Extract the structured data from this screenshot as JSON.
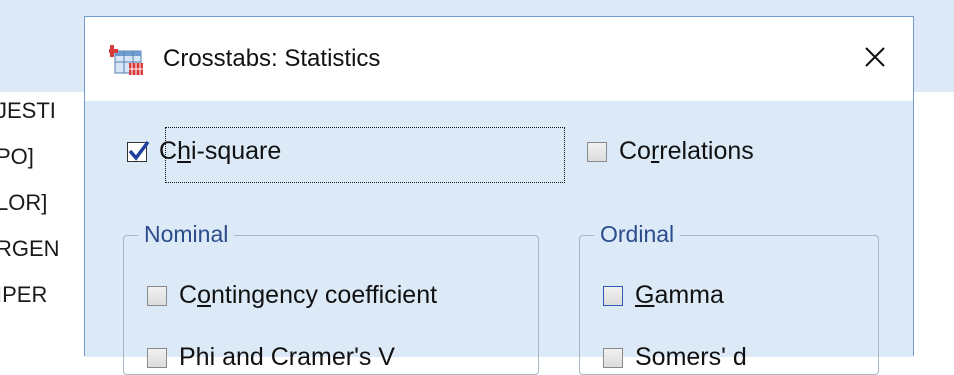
{
  "background_list": {
    "items": [
      "JESTI",
      "PO]",
      "LOR]",
      "RGEN",
      "IPER",
      ""
    ]
  },
  "dialog": {
    "title": "Crosstabs: Statistics",
    "icon": "crosstabs-icon",
    "close_icon": "close-icon",
    "chi_square": {
      "label_pre": "C",
      "label_u": "h",
      "label_post": "i-square",
      "checked": true
    },
    "correlations": {
      "label_pre": "Co",
      "label_u": "r",
      "label_post": "relations",
      "checked": false
    },
    "nominal": {
      "title": "Nominal",
      "items": [
        {
          "label_pre": "C",
          "label_u": "o",
          "label_post": "ntingency coefficient",
          "checked": false
        },
        {
          "label_pre": "",
          "label_u": "",
          "label_post": "Phi and Cramer's V",
          "checked": false
        }
      ]
    },
    "ordinal": {
      "title": "Ordinal",
      "items": [
        {
          "label_pre": "",
          "label_u": "G",
          "label_post": "amma",
          "checked": false
        },
        {
          "label_pre": "",
          "label_u": "",
          "label_post": "Somers' d",
          "checked": false
        }
      ]
    }
  },
  "colors": {
    "dialog_bg": "#dce9f7",
    "title_bg": "#ffffff",
    "border": "#6f9bd1",
    "group_title": "#2b4b8c",
    "check_mark": "#1f3f9c"
  }
}
